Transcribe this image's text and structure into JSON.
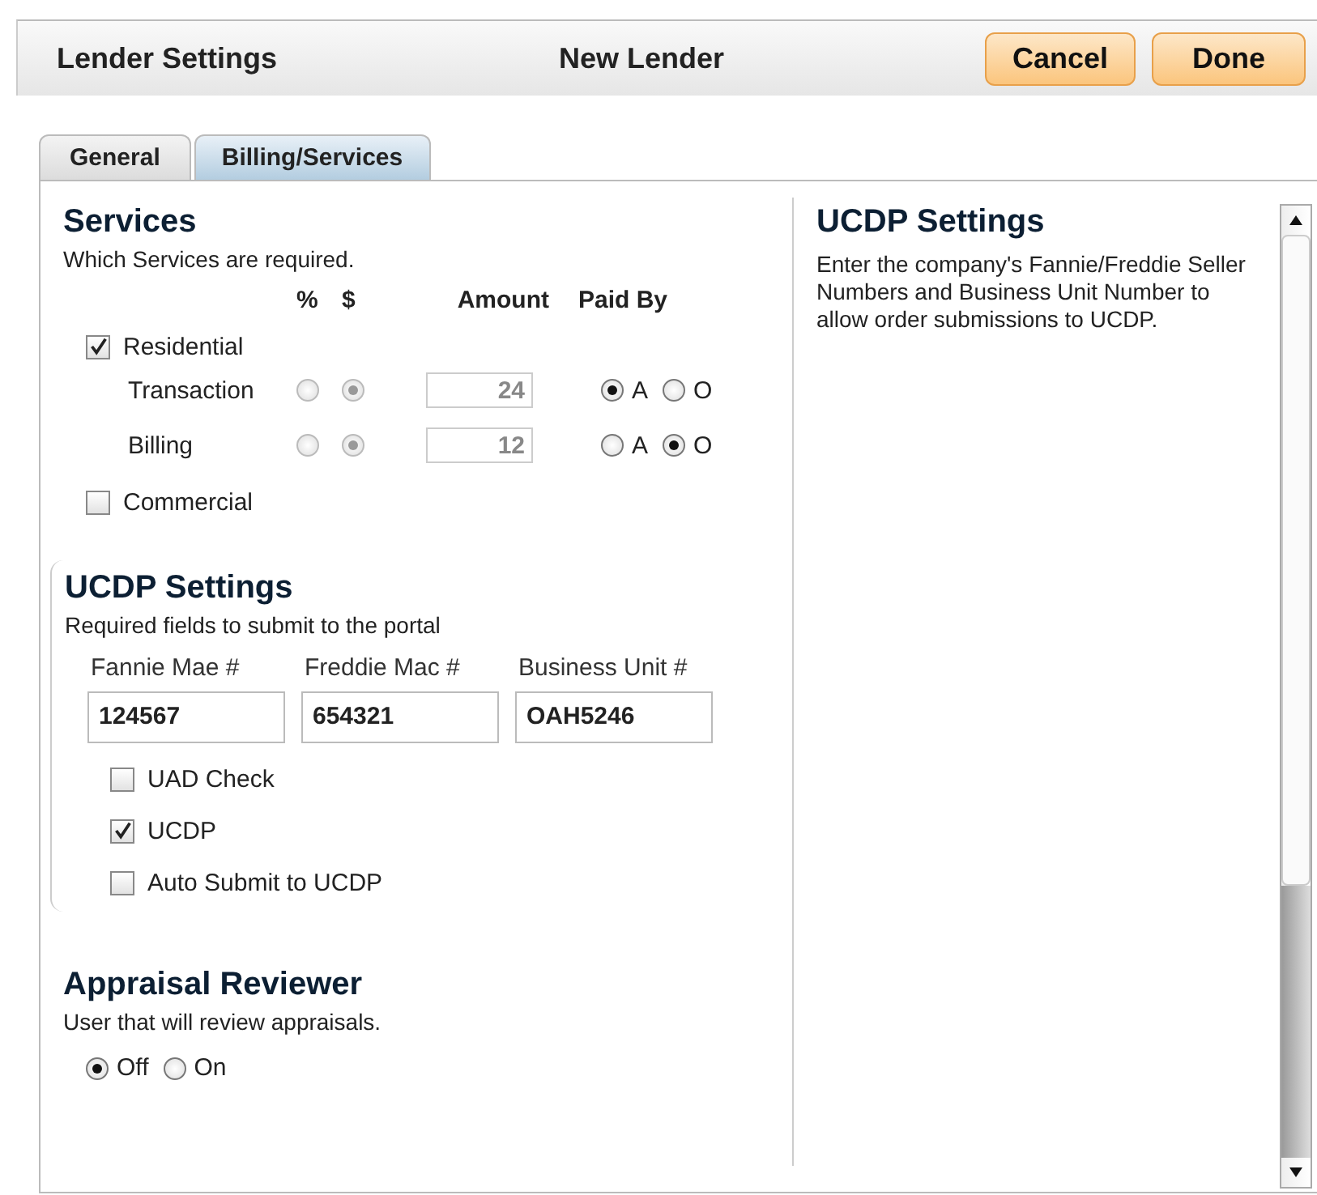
{
  "header": {
    "title": "Lender Settings",
    "subtitle": "New Lender",
    "buttons": [
      "Cancel",
      "Done"
    ]
  },
  "tabs": [
    {
      "label": "General",
      "selected": false
    },
    {
      "label": "Billing/Services",
      "selected": true
    }
  ],
  "services": {
    "title": "Services",
    "description": "Which Services are required.",
    "columns": [
      "%",
      "$",
      "Amount",
      "Paid By"
    ],
    "categories": [
      {
        "label": "Residential",
        "checked": true,
        "rows": [
          {
            "label": "Transaction",
            "disabled": true,
            "units": [
              {
                "selected": false
              },
              {
                "selected": true
              }
            ],
            "amount": "24",
            "paid_by": [
              {
                "label": "A",
                "selected": true
              },
              {
                "label": "O",
                "selected": false
              }
            ]
          },
          {
            "label": "Billing",
            "disabled": true,
            "units": [
              {
                "selected": false
              },
              {
                "selected": true
              }
            ],
            "amount": "12",
            "paid_by": [
              {
                "label": "A",
                "selected": false
              },
              {
                "label": "O",
                "selected": true
              }
            ]
          }
        ]
      },
      {
        "label": "Commercial",
        "checked": false
      }
    ]
  },
  "ucdp": {
    "title": "UCDP Settings",
    "description": "Required fields to submit to the portal",
    "fields": [
      {
        "label": "Fannie Mae #",
        "value": "124567"
      },
      {
        "label": "Freddie Mac #",
        "value": "654321"
      },
      {
        "label": "Business Unit #",
        "value": "OAH5246"
      }
    ],
    "options": [
      {
        "label": "UAD Check",
        "checked": false
      },
      {
        "label": "UCDP",
        "checked": true
      },
      {
        "label": "Auto Submit to UCDP",
        "checked": false
      }
    ]
  },
  "reviewer": {
    "title": "Appraisal Reviewer",
    "description": "User that will review appraisals.",
    "options": [
      {
        "label": "Off",
        "selected": true
      },
      {
        "label": "On",
        "selected": false
      }
    ]
  },
  "help": {
    "title": "UCDP Settings",
    "text": "Enter the company's Fannie/Freddie Seller Numbers and Business Unit Number to allow order submissions to UCDP."
  }
}
